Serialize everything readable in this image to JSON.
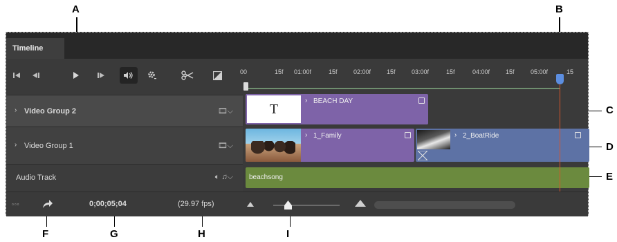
{
  "callouts": {
    "a": "A",
    "b": "B",
    "c": "C",
    "d": "D",
    "e": "E",
    "f": "F",
    "g": "G",
    "h": "H",
    "i": "I"
  },
  "panel": {
    "tab_label": "Timeline"
  },
  "ruler": {
    "ticks": [
      "00",
      "15f",
      "01:00f",
      "15f",
      "02:00f",
      "15f",
      "03:00f",
      "15f",
      "04:00f",
      "15f",
      "05:00f",
      "15"
    ]
  },
  "tracks": {
    "video_group_2": {
      "label": "Video Group 2"
    },
    "video_group_1": {
      "label": "Video Group 1"
    },
    "audio": {
      "label": "Audio Track"
    }
  },
  "clips": {
    "beach_day": {
      "title": "BEACH DAY",
      "thumb_text": "T"
    },
    "family": {
      "title": "1_Family"
    },
    "boatride": {
      "title": "2_BoatRide"
    },
    "beachsong": {
      "title": "beachsong"
    }
  },
  "bottom": {
    "timecode": "0;00;05;04",
    "fps": "(29.97 fps)"
  },
  "colors": {
    "purple_clip": "#7e63a8",
    "blue_clip": "#5d72a5",
    "audio_clip": "#6b8a3e",
    "playhead": "#d9542b",
    "playhead_handle": "#5c8ee0"
  },
  "icons": {
    "go_to_first": "first-frame-icon",
    "prev_frame": "previous-frame-icon",
    "play": "play-icon",
    "next_frame": "next-frame-icon",
    "volume": "speaker-icon",
    "settings": "gear-icon",
    "split": "scissors-icon",
    "transition": "transition-icon"
  }
}
